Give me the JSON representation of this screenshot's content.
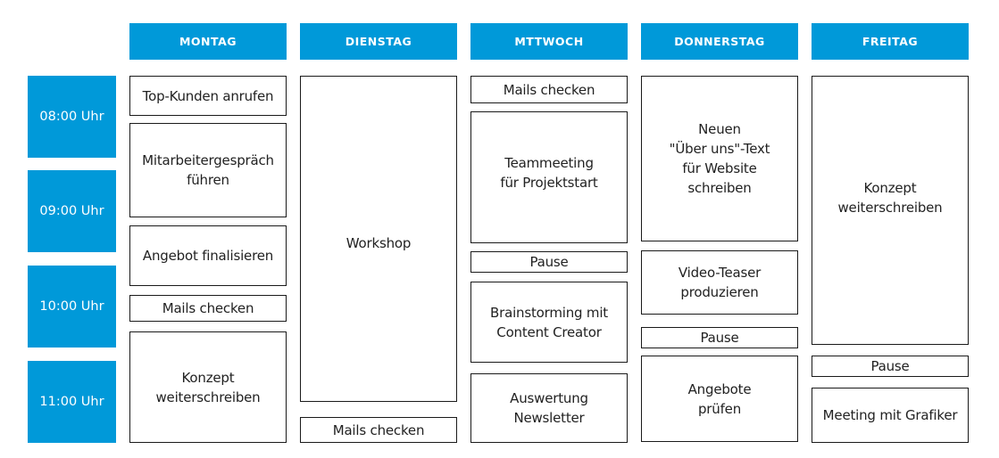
{
  "colors": {
    "accent": "#0099d9"
  },
  "days": [
    {
      "label": "MONTAG"
    },
    {
      "label": "DIENSTAG"
    },
    {
      "label": "MTTWOCH"
    },
    {
      "label": "DONNERSTAG"
    },
    {
      "label": "FREITAG"
    }
  ],
  "times": [
    "08:00 Uhr",
    "09:00 Uhr",
    "10:00 Uhr",
    "11:00 Uhr"
  ],
  "tasks": {
    "montag": [
      "Top-Kunden anrufen",
      "Mitarbeitergespräch\nführen",
      "Angebot finalisieren",
      "Mails checken",
      "Konzept\nweiterschreiben"
    ],
    "dienstag": [
      "Workshop",
      "Mails checken"
    ],
    "mittwoch": [
      "Mails checken",
      "Teammeeting\nfür Projektstart",
      "Pause",
      "Brainstorming mit\nContent Creator",
      "Auswertung\nNewsletter"
    ],
    "donnerstag": [
      "Neuen\n\"Über uns\"-Text\nfür Website\nschreiben",
      "Video-Teaser\nproduzieren",
      "Pause",
      "Angebote\nprüfen"
    ],
    "freitag": [
      "Konzept\nweiterschreiben",
      "Pause",
      "Meeting mit Grafiker"
    ]
  }
}
